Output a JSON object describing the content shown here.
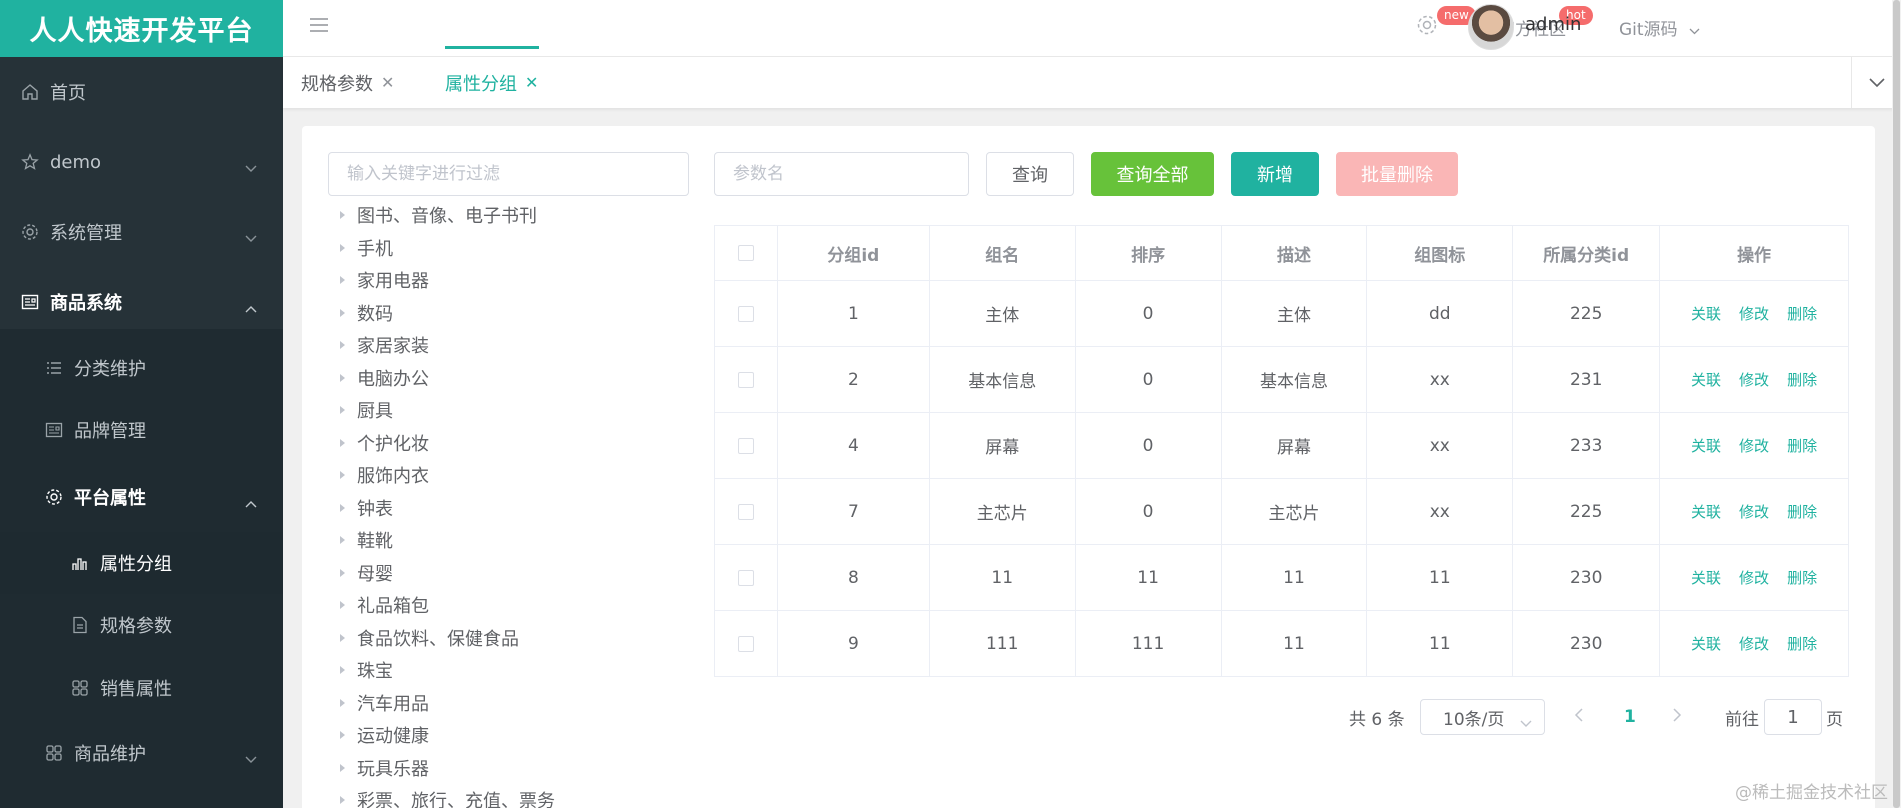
{
  "brand": "人人快速开发平台",
  "sidebar": {
    "items": [
      {
        "label": "首页",
        "icon": "home-icon"
      },
      {
        "label": "demo",
        "icon": "star-icon"
      },
      {
        "label": "系统管理",
        "icon": "gear-icon"
      },
      {
        "label": "商品系统",
        "icon": "product-icon"
      },
      {
        "label": "分类维护",
        "icon": "list-icon"
      },
      {
        "label": "品牌管理",
        "icon": "brand-icon"
      },
      {
        "label": "平台属性",
        "icon": "gear-icon"
      },
      {
        "label": "属性分组",
        "icon": "bar-chart-icon"
      },
      {
        "label": "规格参数",
        "icon": "document-icon"
      },
      {
        "label": "销售属性",
        "icon": "grid-icon"
      },
      {
        "label": "商品维护",
        "icon": "grid-icon"
      }
    ]
  },
  "header": {
    "badge_new": "new",
    "community": "官方社区",
    "badge_hot": "hot",
    "git": "Git源码",
    "username": "admin"
  },
  "tabs": [
    {
      "label": "规格参数"
    },
    {
      "label": "属性分组"
    }
  ],
  "filter": {
    "placeholder": "输入关键字进行过滤"
  },
  "search": {
    "placeholder": "参数名"
  },
  "buttons": {
    "query": "查询",
    "query_all": "查询全部",
    "add": "新增",
    "batch_delete": "批量删除"
  },
  "tree": [
    "图书、音像、电子书刊",
    "手机",
    "家用电器",
    "数码",
    "家居家装",
    "电脑办公",
    "厨具",
    "个护化妆",
    "服饰内衣",
    "钟表",
    "鞋靴",
    "母婴",
    "礼品箱包",
    "食品饮料、保健食品",
    "珠宝",
    "汽车用品",
    "运动健康",
    "玩具乐器",
    "彩票、旅行、充值、票务"
  ],
  "table": {
    "headers": [
      "分组id",
      "组名",
      "排序",
      "描述",
      "组图标",
      "所属分类id",
      "操作"
    ],
    "rows": [
      [
        "1",
        "主体",
        "0",
        "主体",
        "dd",
        "225"
      ],
      [
        "2",
        "基本信息",
        "0",
        "基本信息",
        "xx",
        "231"
      ],
      [
        "4",
        "屏幕",
        "0",
        "屏幕",
        "xx",
        "233"
      ],
      [
        "7",
        "主芯片",
        "0",
        "主芯片",
        "xx",
        "225"
      ],
      [
        "8",
        "11",
        "11",
        "11",
        "11",
        "230"
      ],
      [
        "9",
        "111",
        "111",
        "11",
        "11",
        "230"
      ]
    ],
    "ops": [
      "关联",
      "修改",
      "删除"
    ]
  },
  "pagination": {
    "total": "共 6 条",
    "page_size": "10条/页",
    "current": "1",
    "goto_prefix": "前往",
    "goto_value": "1",
    "goto_suffix": "页"
  },
  "watermark": "@稀土掘金技术社区",
  "colors": {
    "accent": "#20b2a0",
    "sidebar": "#263238",
    "success": "#67c23a",
    "danger_disabled": "#fab6b6",
    "badge": "#f56c6c"
  }
}
